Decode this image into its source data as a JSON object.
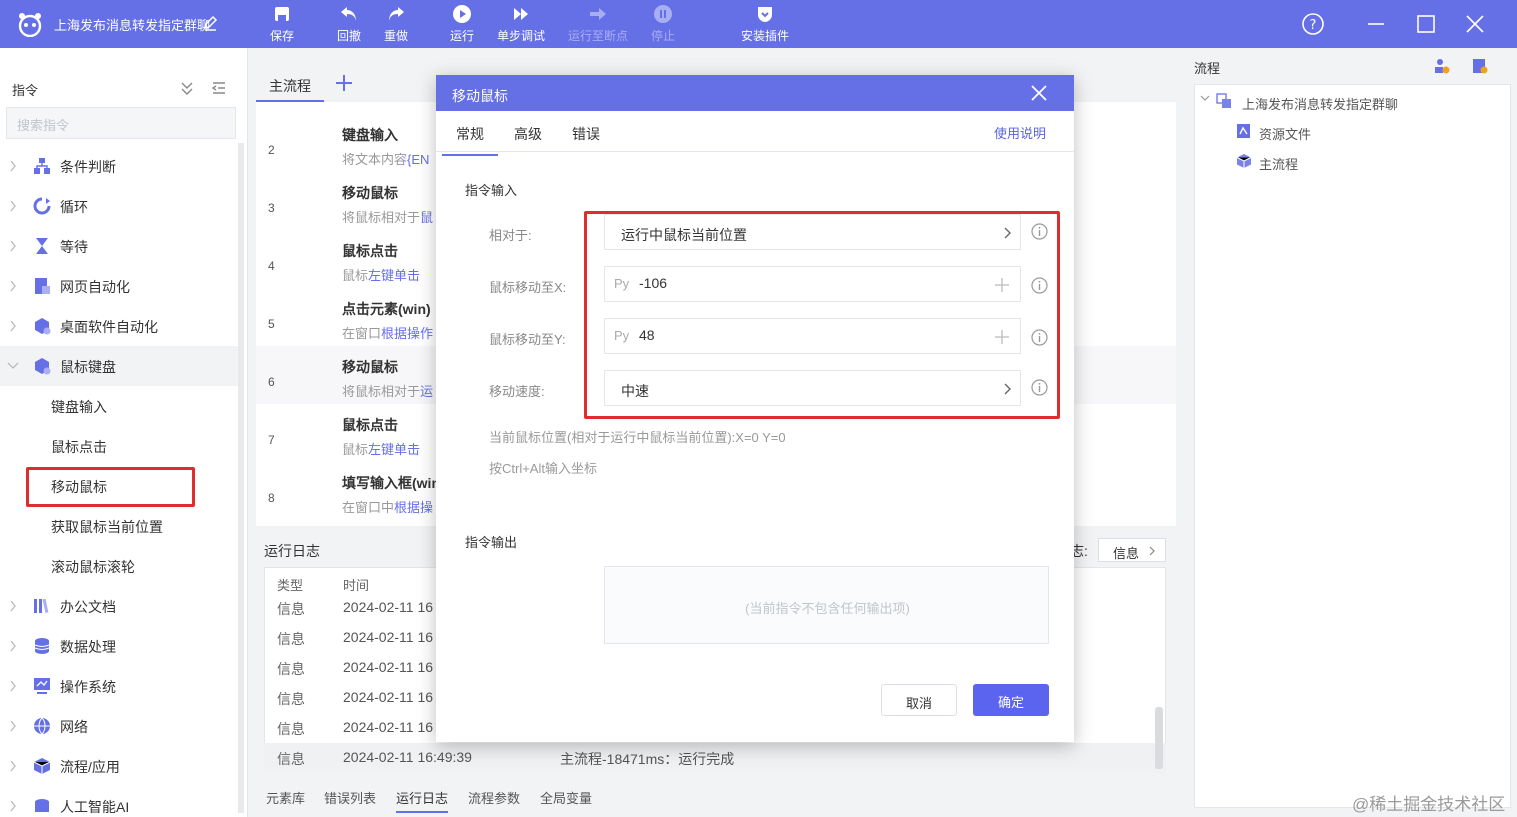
{
  "window": {
    "title": "上海发布消息转发指定群聊"
  },
  "toolbar": [
    {
      "label": "保存",
      "icon": "save-icon",
      "disabled": false
    },
    {
      "label": "回撤",
      "icon": "undo-icon",
      "disabled": false
    },
    {
      "label": "重做",
      "icon": "redo-icon",
      "disabled": false
    },
    {
      "label": "运行",
      "icon": "play-icon",
      "disabled": false
    },
    {
      "label": "单步调试",
      "icon": "step-debug-icon",
      "disabled": false
    },
    {
      "label": "运行至断点",
      "icon": "run-to-breakpoint-icon",
      "disabled": true
    },
    {
      "label": "停止",
      "icon": "stop-icon",
      "disabled": true
    },
    {
      "label": "安装插件",
      "icon": "plugin-icon",
      "disabled": false
    }
  ],
  "left_panel": {
    "heading": "指令",
    "search_placeholder": "搜索指令",
    "categories": [
      {
        "label": "条件判断",
        "icon": "condition-icon"
      },
      {
        "label": "循环",
        "icon": "loop-icon"
      },
      {
        "label": "等待",
        "icon": "hourglass-icon"
      },
      {
        "label": "网页自动化",
        "icon": "web-automation-icon"
      },
      {
        "label": "桌面软件自动化",
        "icon": "desktop-automation-icon"
      },
      {
        "label": "鼠标键盘",
        "icon": "mouse-keyboard-icon"
      }
    ],
    "sub_items": [
      "键盘输入",
      "鼠标点击",
      "移动鼠标",
      "获取鼠标当前位置",
      "滚动鼠标滚轮"
    ],
    "more_categories": [
      {
        "label": "办公文档",
        "icon": "office-doc-icon"
      },
      {
        "label": "数据处理",
        "icon": "data-icon"
      },
      {
        "label": "操作系统",
        "icon": "os-icon"
      },
      {
        "label": "网络",
        "icon": "globe-icon"
      },
      {
        "label": "流程/应用",
        "icon": "cube-icon"
      },
      {
        "label": "人工智能AI",
        "icon": "ai-icon"
      }
    ]
  },
  "editor": {
    "tab": "主流程",
    "rows": [
      {
        "line": "2",
        "title": "键盘输入",
        "desc": "将文本内容",
        "hl": "{EN"
      },
      {
        "line": "3",
        "title": "移动鼠标",
        "desc": "将鼠标相对于",
        "hl": "鼠"
      },
      {
        "line": "4",
        "title": "鼠标点击",
        "desc": "鼠标",
        "hl": "左键单击"
      },
      {
        "line": "5",
        "title": "点击元素(win)",
        "desc": "在窗口",
        "hl": "根据操作"
      },
      {
        "line": "6",
        "title": "移动鼠标",
        "desc": "将鼠标相对于",
        "hl": "运"
      },
      {
        "line": "7",
        "title": "鼠标点击",
        "desc": "鼠标",
        "hl": "左键单击"
      },
      {
        "line": "8",
        "title": "填写输入框(win",
        "desc": "在窗口中",
        "hl": "根据操"
      }
    ]
  },
  "log": {
    "title": "运行日志",
    "level_label": "志:",
    "filter_value": "信息",
    "columns": [
      "类型",
      "时间"
    ],
    "rows": [
      {
        "type": "信息",
        "time": "2024-02-11 16",
        "msg": ""
      },
      {
        "type": "信息",
        "time": "2024-02-11 16",
        "msg": ""
      },
      {
        "type": "信息",
        "time": "2024-02-11 16",
        "msg": ""
      },
      {
        "type": "信息",
        "time": "2024-02-11 16",
        "msg": ""
      },
      {
        "type": "信息",
        "time": "2024-02-11 16",
        "msg": ""
      },
      {
        "type": "信息",
        "time": "2024-02-11 16:49:39",
        "msg": "主流程-18471ms：运行完成"
      }
    ]
  },
  "bottom_tabs": [
    "元素库",
    "错误列表",
    "运行日志",
    "流程参数",
    "全局变量"
  ],
  "right_panel": {
    "title": "流程",
    "project": "上海发布消息转发指定群聊",
    "items": [
      "资源文件",
      "主流程"
    ]
  },
  "dialog": {
    "title": "移动鼠标",
    "tabs": [
      "常规",
      "高级",
      "错误"
    ],
    "help": "使用说明",
    "input_section": "指令输入",
    "fields": {
      "relative_label": "相对于:",
      "relative_value": "运行中鼠标当前位置",
      "x_label": "鼠标移动至X:",
      "x_prefix": "Py",
      "x_value": "-106",
      "y_label": "鼠标移动至Y:",
      "y_prefix": "Py",
      "y_value": "48",
      "speed_label": "移动速度:",
      "speed_value": "中速"
    },
    "hint_position": "当前鼠标位置(相对于运行中鼠标当前位置):X=0 Y=0",
    "hint_shortcut": "按Ctrl+Alt输入坐标",
    "output_section": "指令输出",
    "output_empty": "(当前指令不包含任何输出项)",
    "cancel": "取消",
    "ok": "确定"
  },
  "watermark": "@稀土掘金技术社区",
  "colors": {
    "accent": "#6670e6",
    "highlight_border": "#e02c2c",
    "primary_button": "#5b64ee"
  }
}
